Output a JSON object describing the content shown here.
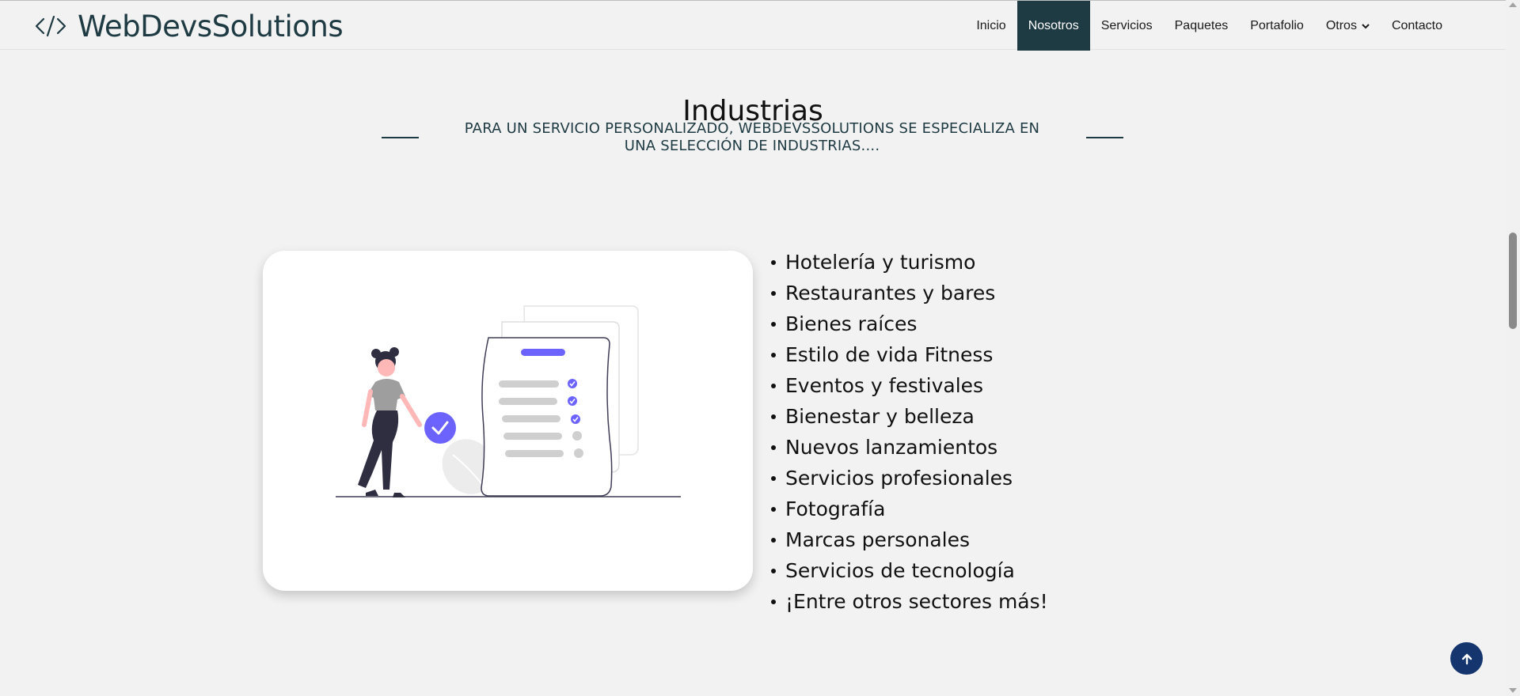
{
  "header": {
    "brand_name": "WebDevsSolutions",
    "brand_icon": "code-icon",
    "nav": [
      {
        "label": "Inicio"
      },
      {
        "label": "Nosotros",
        "active": true
      },
      {
        "label": "Servicios"
      },
      {
        "label": "Paquetes"
      },
      {
        "label": "Portafolio"
      },
      {
        "label": "Otros",
        "dropdown": true
      },
      {
        "label": "Contacto"
      }
    ],
    "active_color": "#1e3a43"
  },
  "section": {
    "title": "Industrias",
    "subtitle": "PARA UN SERVICIO PERSONALIZADO, WEBDEVSSOLUTIONS SE ESPECIALIZA EN UNA SELECCIÓN DE INDUSTRIAS...."
  },
  "industries": [
    "Hotelería y turismo",
    "Restaurantes y bares",
    "Bienes raíces",
    "Estilo de vida Fitness",
    "Eventos y festivales",
    "Bienestar y belleza",
    "Nuevos lanzamientos",
    "Servicios profesionales",
    "Fotografía",
    "Marcas personales",
    "Servicios de tecnología",
    "¡Entre otros sectores más!"
  ],
  "illustration": {
    "icon": "checklist-illustration",
    "accent_color": "#6c63ff"
  },
  "back_to_top": {
    "icon": "arrow-up-icon",
    "color": "#14356e"
  }
}
